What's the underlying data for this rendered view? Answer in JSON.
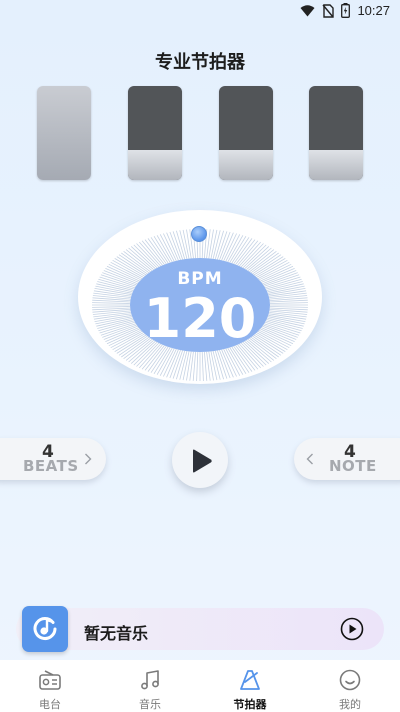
{
  "status_bar": {
    "time": "10:27",
    "icons": [
      "wifi-icon",
      "no-sim-icon",
      "battery-charging-icon"
    ]
  },
  "page": {
    "title": "专业节拍器"
  },
  "beat_pattern": {
    "count": 4,
    "states": [
      "accent",
      "normal",
      "normal",
      "normal"
    ]
  },
  "tempo": {
    "label": "BPM",
    "value": "120"
  },
  "beats_selector": {
    "value": "4",
    "label": "BEATS",
    "icon": "chevron-right-icon"
  },
  "note_selector": {
    "value": "4",
    "label": "NOTE",
    "icon": "chevron-left-icon"
  },
  "play_button": {
    "icon": "play-icon"
  },
  "music_player": {
    "title": "暂无音乐",
    "cover_icon": "music-note-icon",
    "play_icon": "play-circle-icon"
  },
  "tabs": [
    {
      "label": "电台",
      "icon": "radio-icon",
      "active": false
    },
    {
      "label": "音乐",
      "icon": "music-icon",
      "active": false
    },
    {
      "label": "节拍器",
      "icon": "metronome-icon",
      "active": true
    },
    {
      "label": "我的",
      "icon": "smile-icon",
      "active": false
    }
  ],
  "colors": {
    "accent": "#5694ea",
    "bpm_center": "#8fb3ef",
    "beat_dark": "#525558"
  }
}
